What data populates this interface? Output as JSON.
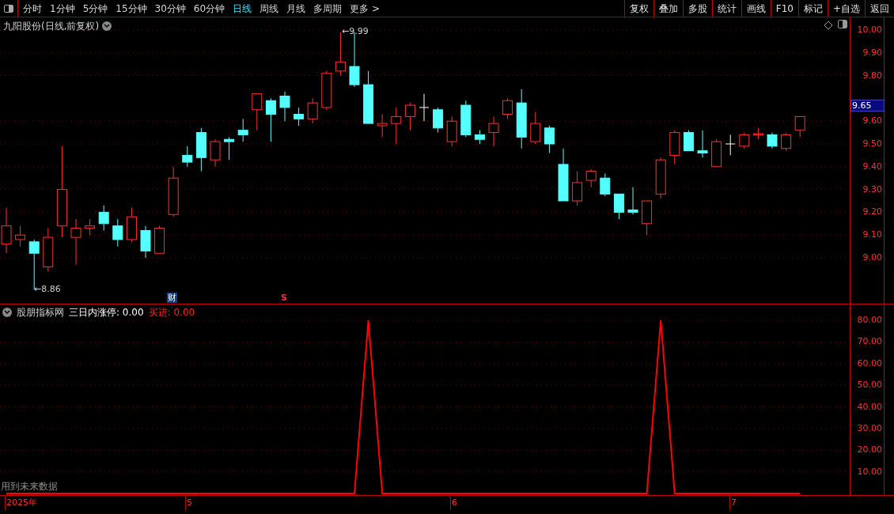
{
  "toolbar": {
    "periods": [
      {
        "label": "分时",
        "selected": false
      },
      {
        "label": "1分钟",
        "selected": false
      },
      {
        "label": "5分钟",
        "selected": false
      },
      {
        "label": "15分钟",
        "selected": false
      },
      {
        "label": "30分钟",
        "selected": false
      },
      {
        "label": "60分钟",
        "selected": false
      },
      {
        "label": "日线",
        "selected": true
      },
      {
        "label": "周线",
        "selected": false
      },
      {
        "label": "月线",
        "selected": false
      },
      {
        "label": "多周期",
        "selected": false
      },
      {
        "label": "更多 >",
        "selected": false
      }
    ],
    "buttons": [
      "复权",
      "叠加",
      "多股",
      "统计",
      "画线",
      "F10",
      "标记",
      "+自选",
      "返回"
    ]
  },
  "price_panel": {
    "title": "九阳股份(日线,前复权)",
    "axis_labels": [
      "10.00",
      "9.90",
      "9.80",
      "9.60",
      "9.50",
      "9.40",
      "9.30",
      "9.20",
      "9.10",
      "9.00"
    ],
    "current_price": "9.65",
    "high_marker": "←9.99",
    "low_marker": "←8.86",
    "event_badges": [
      {
        "label": "财",
        "kind": "finance"
      },
      {
        "label": "S",
        "kind": "signal"
      }
    ]
  },
  "indicator_panel": {
    "name": "股朋指标网",
    "legend": [
      {
        "label": "三日内涨停: 0.00",
        "color": "#ffffff"
      },
      {
        "label": "买进: 0.00",
        "color": "#ff2020"
      }
    ],
    "note": "用到未来数据",
    "chart_data": {
      "type": "line",
      "grid": true,
      "ylim": [
        0,
        80
      ],
      "yticks": [
        {
          "value": 10,
          "label": "10.00"
        },
        {
          "value": 20,
          "label": "20.00"
        },
        {
          "value": 30,
          "label": "30.00"
        },
        {
          "value": 40,
          "label": "40.00"
        },
        {
          "value": 50,
          "label": "50.00"
        },
        {
          "value": 60,
          "label": "60.00"
        },
        {
          "value": 70,
          "label": "70.00"
        },
        {
          "value": 80,
          "label": "80.00"
        }
      ],
      "series": [
        {
          "color": "#ff0000",
          "values": [
            0,
            0,
            0,
            0,
            0,
            0,
            0,
            0,
            0,
            0,
            0,
            0,
            0,
            0,
            0,
            0,
            0,
            0,
            0,
            0,
            0,
            0,
            0,
            0,
            0,
            0,
            80,
            0,
            0,
            0,
            0,
            0,
            0,
            0,
            0,
            0,
            0,
            0,
            0,
            0,
            0,
            0,
            0,
            0,
            0,
            0,
            0,
            80,
            0,
            0,
            0,
            0,
            0,
            0,
            0,
            0,
            0,
            0
          ]
        }
      ]
    }
  },
  "date_axis": [
    "2025年",
    "5",
    "6",
    "7"
  ]
}
